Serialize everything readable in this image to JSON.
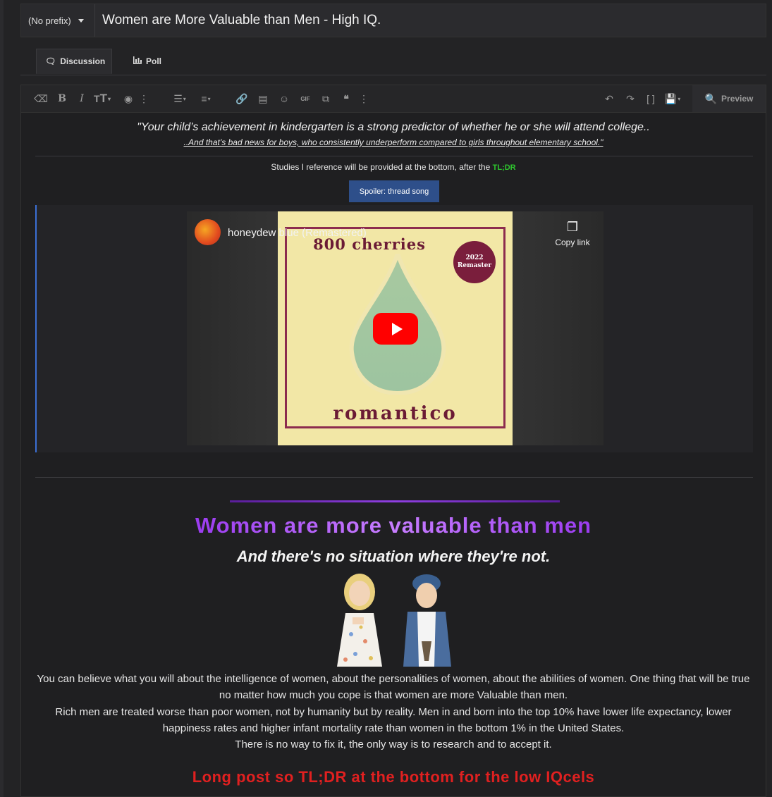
{
  "thread": {
    "prefix": "(No prefix)",
    "title": "Women are More Valuable than Men - High IQ."
  },
  "tabs": [
    {
      "label": "Discussion",
      "icon": "comments-icon",
      "active": true
    },
    {
      "label": "Poll",
      "icon": "bar-chart-icon",
      "active": false
    }
  ],
  "toolbar": {
    "preview_label": "Preview",
    "icons": [
      "eraser-icon",
      "bold-icon",
      "italic-icon",
      "text-size-icon",
      "color-icon",
      "more-icon",
      "list-icon",
      "align-icon",
      "link-icon",
      "image-icon",
      "smilie-icon",
      "gif-icon",
      "media-icon",
      "quote-icon",
      "more-icon",
      "undo-icon",
      "redo-icon",
      "toggle-bbcode-icon",
      "drafts-icon"
    ],
    "text_size_label": "T",
    "gif_label": "GIF"
  },
  "post": {
    "quote_line1": "\"Your child’s achievement in kindergarten is a strong predictor of whether he or she will attend college..",
    "quote_line2": "..And that’s bad news for boys, who consistently underperform compared to girls throughout elementary school.\"",
    "studies_text": "Studies I reference will be provided at the bottom, after the ",
    "studies_tldr": "TL;DR",
    "spoiler_label": "Spoiler: thread song",
    "video": {
      "title": "honeydew blue (Remastered)",
      "copy_link": "Copy link",
      "cover_top": "800 cherries",
      "cover_bottom": "romantico",
      "badge_line1": "2022",
      "badge_line2": "Remaster"
    },
    "heading": "Women are more valuable than men",
    "subheading": "And there's no situation where they're not.",
    "para1": "You can believe what you will about the intelligence of women, about the personalities of women, about the abilities of women. One thing that will be true no matter how much you cope is that women are more Valuable than men.",
    "para2": "Rich men are treated worse than poor women, not by humanity but by reality. Men in and born into the top 10% have lower life expectancy, lower happiness rates and higher infant mortality rate than women in the bottom 1% in the United States.",
    "para3": "There is no way to fix it, the only way is to research and to accept it.",
    "long_post": "Long post so TL;DR at the bottom for the low IQcels"
  },
  "colors": {
    "accent_purple": "#9b3cf0",
    "tldr_green": "#2ec52e",
    "warning_red": "#e02020",
    "spoiler_blue": "#2e4f8a"
  }
}
